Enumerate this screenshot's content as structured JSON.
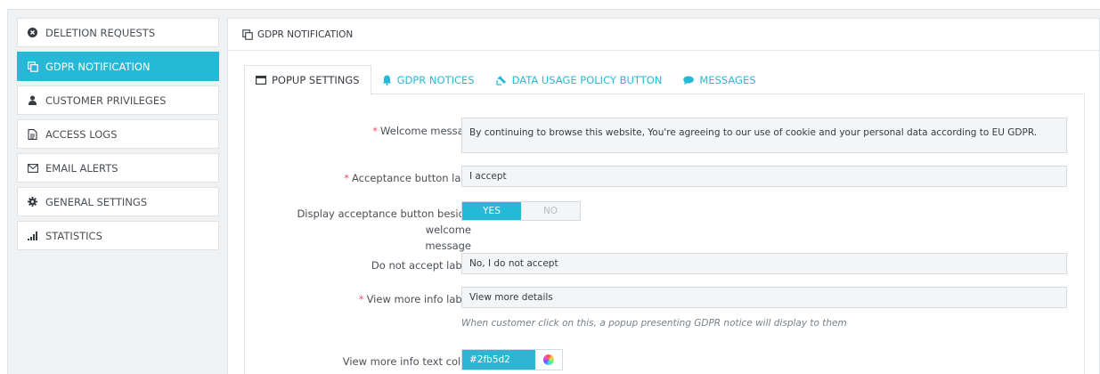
{
  "sidebar": {
    "items": [
      {
        "label": "DELETION REQUESTS",
        "icon": "times-circle-icon",
        "active": false
      },
      {
        "label": "GDPR NOTIFICATION",
        "icon": "copy-icon",
        "active": true
      },
      {
        "label": "CUSTOMER PRIVILEGES",
        "icon": "user-icon",
        "active": false
      },
      {
        "label": "ACCESS LOGS",
        "icon": "document-icon",
        "active": false
      },
      {
        "label": "EMAIL ALERTS",
        "icon": "envelope-icon",
        "active": false
      },
      {
        "label": "GENERAL SETTINGS",
        "icon": "gear-icon",
        "active": false
      },
      {
        "label": "STATISTICS",
        "icon": "bar-chart-icon",
        "active": false
      }
    ]
  },
  "panel": {
    "title": "GDPR NOTIFICATION"
  },
  "tabs": [
    {
      "label": "POPUP SETTINGS",
      "icon": "window-icon",
      "active": true
    },
    {
      "label": "GDPR NOTICES",
      "icon": "bell-icon",
      "active": false
    },
    {
      "label": "DATA USAGE POLICY BUTTON",
      "icon": "pointer-icon",
      "active": false
    },
    {
      "label": "MESSAGES",
      "icon": "chat-icon",
      "active": false
    }
  ],
  "form": {
    "welcome": {
      "label": "Welcome message",
      "required": true,
      "value": "By continuing to browse this website, You're agreeing to our use of cookie and your personal data according to EU GDPR."
    },
    "accept_label": {
      "label": "Acceptance button label",
      "required": true,
      "value": "I accept"
    },
    "display_beside": {
      "label_line1": "Display acceptance button beside welcome",
      "label_line2": "message",
      "yes": "YES",
      "no": "NO",
      "selected": "YES"
    },
    "decline_label": {
      "label": "Do not accept label",
      "value": "No, I do not accept"
    },
    "more_info_label": {
      "label": "View more info label",
      "required": true,
      "value": "View more details",
      "help": "When customer click on this, a popup presenting GDPR notice will display to them"
    },
    "more_info_color": {
      "label": "View more info text color",
      "value": "#2fb5d2"
    }
  },
  "colors": {
    "accent": "#25b9d7",
    "required": "#e84e6a",
    "picker_swatch": "#2fb5d2"
  }
}
